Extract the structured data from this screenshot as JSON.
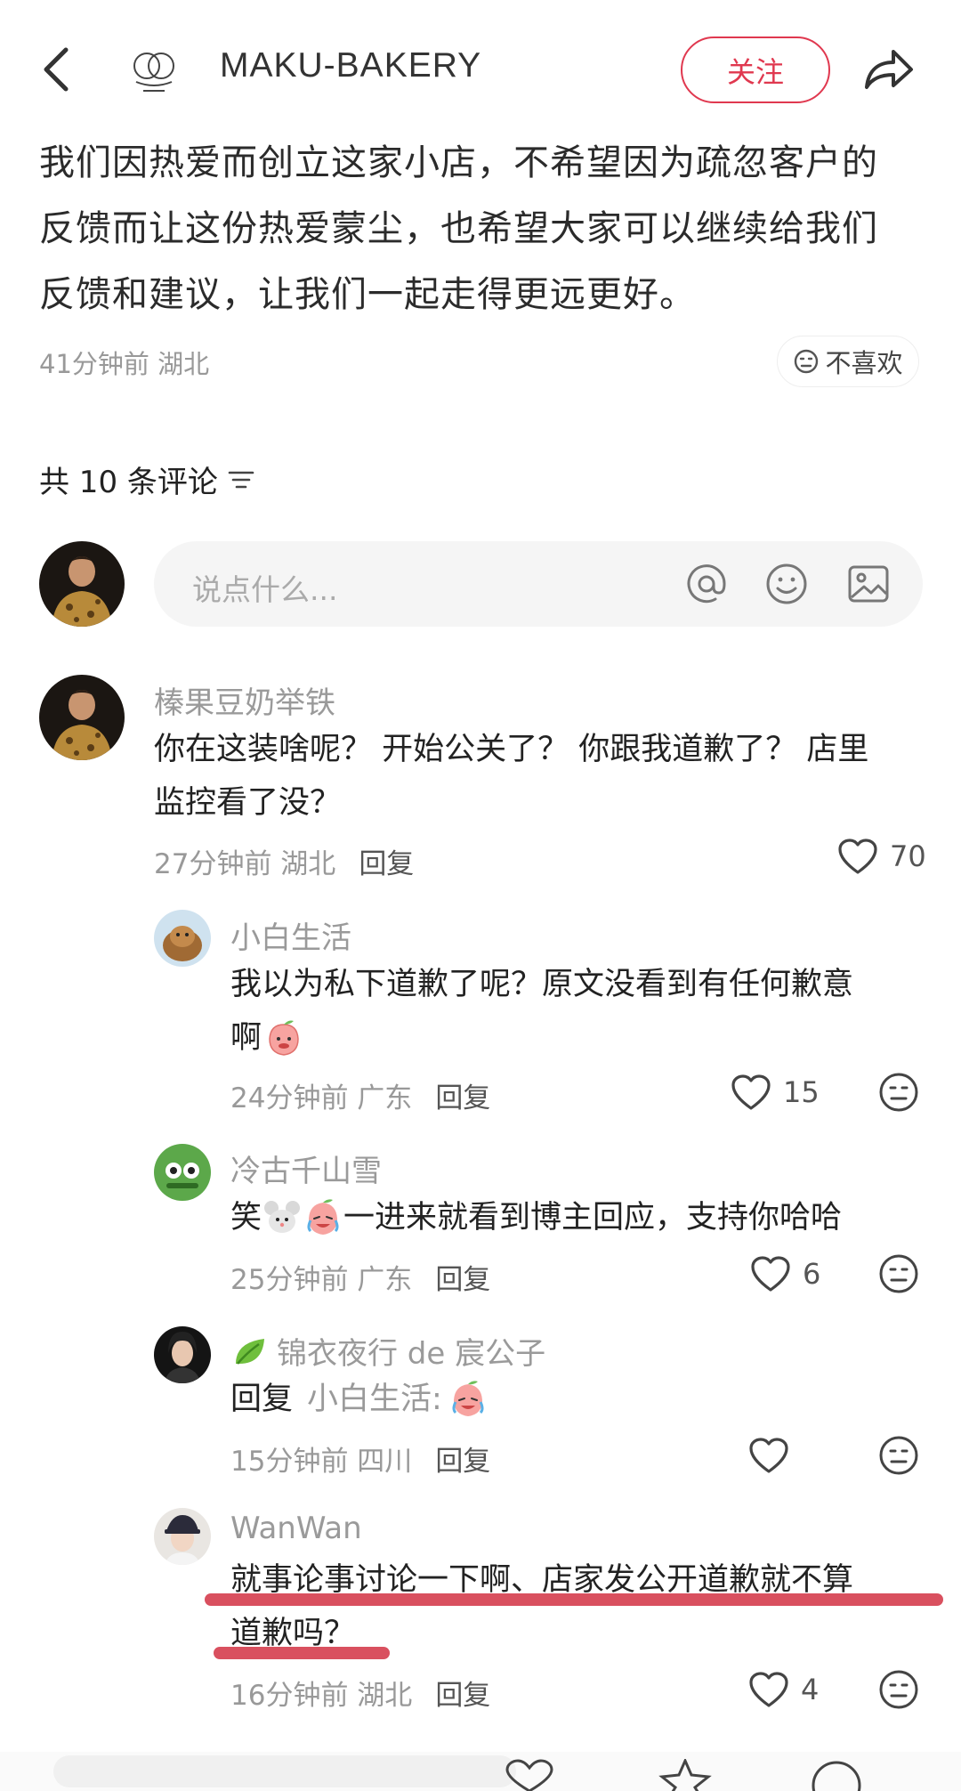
{
  "header": {
    "title": "MAKU-BAKERY",
    "follow_label": "关注"
  },
  "post": {
    "lines": [
      "我们因热爱而创立这家小店，不希望因为疏忽客户的",
      "反馈而让这份热爱蒙尘，也希望大家可以继续给我们",
      "反馈和建议，让我们一起走得更远更好。"
    ],
    "meta": "41分钟前 湖北",
    "dislike_label": "不喜欢"
  },
  "comments_count": "共 10 条评论",
  "input": {
    "placeholder": "说点什么..."
  },
  "comments": [
    {
      "name": "榛果豆奶举铁",
      "lines": [
        "你在这装啥呢？ 开始公关了？ 你跟我道歉了？ 店里",
        "监控看了没？"
      ],
      "time": "27分钟前 湖北",
      "reply_label": "回复",
      "likes": "70"
    },
    {
      "name": "小白生活",
      "lines": [
        "我以为私下道歉了呢？原文没看到有任何歉意",
        "啊"
      ],
      "time": "24分钟前 广东",
      "reply_label": "回复",
      "likes": "15"
    },
    {
      "name": "冷古千山雪",
      "text_a": "笑",
      "text_b": "一进来就看到博主回应，支持你哈哈",
      "time": "25分钟前 广东",
      "reply_label": "回复",
      "likes": "6"
    },
    {
      "name": "锦衣夜行 de 宸公子",
      "reply_prefix": "回复",
      "reply_to": "小白生活:",
      "time": "15分钟前 四川",
      "reply_label": "回复",
      "likes": ""
    },
    {
      "name": "WanWan",
      "lines": [
        "就事论事讨论一下啊、店家发公开道歉就不算",
        "道歉吗？"
      ],
      "time": "16分钟前 湖北",
      "reply_label": "回复",
      "likes": "4"
    }
  ],
  "colors": {
    "accent": "#e0384f",
    "underline": "#d9505f"
  }
}
